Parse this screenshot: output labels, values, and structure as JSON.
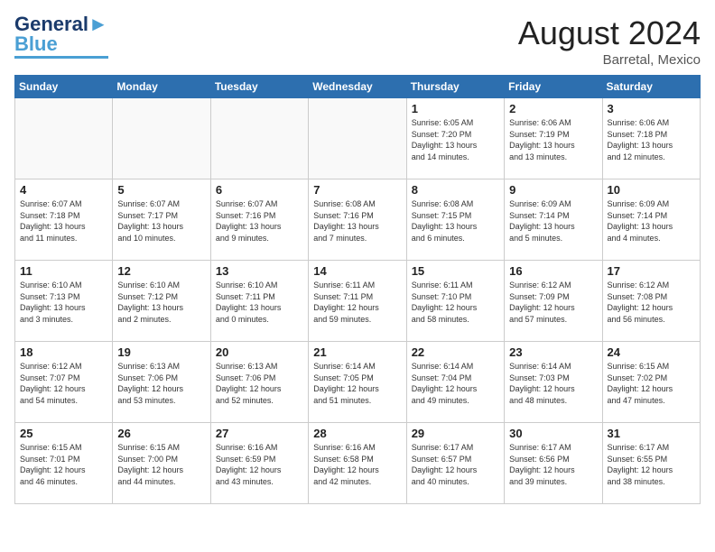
{
  "header": {
    "logo_general": "General",
    "logo_blue": "Blue",
    "month_title": "August 2024",
    "location": "Barretal, Mexico"
  },
  "weekdays": [
    "Sunday",
    "Monday",
    "Tuesday",
    "Wednesday",
    "Thursday",
    "Friday",
    "Saturday"
  ],
  "weeks": [
    [
      {
        "day": "",
        "info": ""
      },
      {
        "day": "",
        "info": ""
      },
      {
        "day": "",
        "info": ""
      },
      {
        "day": "",
        "info": ""
      },
      {
        "day": "1",
        "info": "Sunrise: 6:05 AM\nSunset: 7:20 PM\nDaylight: 13 hours\nand 14 minutes."
      },
      {
        "day": "2",
        "info": "Sunrise: 6:06 AM\nSunset: 7:19 PM\nDaylight: 13 hours\nand 13 minutes."
      },
      {
        "day": "3",
        "info": "Sunrise: 6:06 AM\nSunset: 7:18 PM\nDaylight: 13 hours\nand 12 minutes."
      }
    ],
    [
      {
        "day": "4",
        "info": "Sunrise: 6:07 AM\nSunset: 7:18 PM\nDaylight: 13 hours\nand 11 minutes."
      },
      {
        "day": "5",
        "info": "Sunrise: 6:07 AM\nSunset: 7:17 PM\nDaylight: 13 hours\nand 10 minutes."
      },
      {
        "day": "6",
        "info": "Sunrise: 6:07 AM\nSunset: 7:16 PM\nDaylight: 13 hours\nand 9 minutes."
      },
      {
        "day": "7",
        "info": "Sunrise: 6:08 AM\nSunset: 7:16 PM\nDaylight: 13 hours\nand 7 minutes."
      },
      {
        "day": "8",
        "info": "Sunrise: 6:08 AM\nSunset: 7:15 PM\nDaylight: 13 hours\nand 6 minutes."
      },
      {
        "day": "9",
        "info": "Sunrise: 6:09 AM\nSunset: 7:14 PM\nDaylight: 13 hours\nand 5 minutes."
      },
      {
        "day": "10",
        "info": "Sunrise: 6:09 AM\nSunset: 7:14 PM\nDaylight: 13 hours\nand 4 minutes."
      }
    ],
    [
      {
        "day": "11",
        "info": "Sunrise: 6:10 AM\nSunset: 7:13 PM\nDaylight: 13 hours\nand 3 minutes."
      },
      {
        "day": "12",
        "info": "Sunrise: 6:10 AM\nSunset: 7:12 PM\nDaylight: 13 hours\nand 2 minutes."
      },
      {
        "day": "13",
        "info": "Sunrise: 6:10 AM\nSunset: 7:11 PM\nDaylight: 13 hours\nand 0 minutes."
      },
      {
        "day": "14",
        "info": "Sunrise: 6:11 AM\nSunset: 7:11 PM\nDaylight: 12 hours\nand 59 minutes."
      },
      {
        "day": "15",
        "info": "Sunrise: 6:11 AM\nSunset: 7:10 PM\nDaylight: 12 hours\nand 58 minutes."
      },
      {
        "day": "16",
        "info": "Sunrise: 6:12 AM\nSunset: 7:09 PM\nDaylight: 12 hours\nand 57 minutes."
      },
      {
        "day": "17",
        "info": "Sunrise: 6:12 AM\nSunset: 7:08 PM\nDaylight: 12 hours\nand 56 minutes."
      }
    ],
    [
      {
        "day": "18",
        "info": "Sunrise: 6:12 AM\nSunset: 7:07 PM\nDaylight: 12 hours\nand 54 minutes."
      },
      {
        "day": "19",
        "info": "Sunrise: 6:13 AM\nSunset: 7:06 PM\nDaylight: 12 hours\nand 53 minutes."
      },
      {
        "day": "20",
        "info": "Sunrise: 6:13 AM\nSunset: 7:06 PM\nDaylight: 12 hours\nand 52 minutes."
      },
      {
        "day": "21",
        "info": "Sunrise: 6:14 AM\nSunset: 7:05 PM\nDaylight: 12 hours\nand 51 minutes."
      },
      {
        "day": "22",
        "info": "Sunrise: 6:14 AM\nSunset: 7:04 PM\nDaylight: 12 hours\nand 49 minutes."
      },
      {
        "day": "23",
        "info": "Sunrise: 6:14 AM\nSunset: 7:03 PM\nDaylight: 12 hours\nand 48 minutes."
      },
      {
        "day": "24",
        "info": "Sunrise: 6:15 AM\nSunset: 7:02 PM\nDaylight: 12 hours\nand 47 minutes."
      }
    ],
    [
      {
        "day": "25",
        "info": "Sunrise: 6:15 AM\nSunset: 7:01 PM\nDaylight: 12 hours\nand 46 minutes."
      },
      {
        "day": "26",
        "info": "Sunrise: 6:15 AM\nSunset: 7:00 PM\nDaylight: 12 hours\nand 44 minutes."
      },
      {
        "day": "27",
        "info": "Sunrise: 6:16 AM\nSunset: 6:59 PM\nDaylight: 12 hours\nand 43 minutes."
      },
      {
        "day": "28",
        "info": "Sunrise: 6:16 AM\nSunset: 6:58 PM\nDaylight: 12 hours\nand 42 minutes."
      },
      {
        "day": "29",
        "info": "Sunrise: 6:17 AM\nSunset: 6:57 PM\nDaylight: 12 hours\nand 40 minutes."
      },
      {
        "day": "30",
        "info": "Sunrise: 6:17 AM\nSunset: 6:56 PM\nDaylight: 12 hours\nand 39 minutes."
      },
      {
        "day": "31",
        "info": "Sunrise: 6:17 AM\nSunset: 6:55 PM\nDaylight: 12 hours\nand 38 minutes."
      }
    ]
  ]
}
